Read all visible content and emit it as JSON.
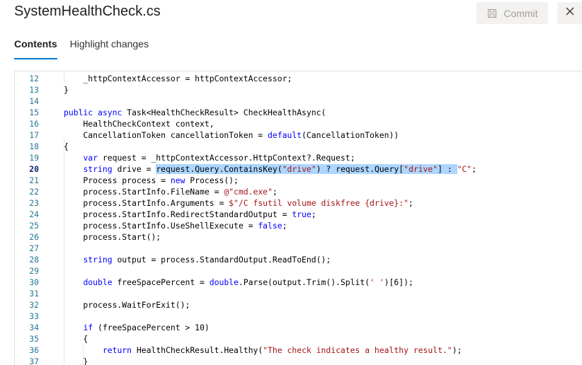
{
  "header": {
    "file_name": "SystemHealthCheck.cs",
    "commit_label": "Commit",
    "commit_icon": "save-icon",
    "close_icon": "close-icon"
  },
  "tabs": [
    {
      "label": "Contents",
      "active": true
    },
    {
      "label": "Highlight changes",
      "active": false
    }
  ],
  "editor": {
    "current_line": 20,
    "lines": [
      {
        "n": "12",
        "parts": [
          {
            "t": "        _httpContextAccessor = httpContextAccessor;"
          }
        ]
      },
      {
        "n": "13",
        "parts": [
          {
            "t": "    }"
          }
        ]
      },
      {
        "n": "14",
        "parts": [
          {
            "t": ""
          }
        ]
      },
      {
        "n": "15",
        "parts": [
          {
            "t": "    "
          },
          {
            "t": "public",
            "c": "kw"
          },
          {
            "t": " "
          },
          {
            "t": "async",
            "c": "kw"
          },
          {
            "t": " Task<HealthCheckResult> CheckHealthAsync("
          }
        ]
      },
      {
        "n": "16",
        "parts": [
          {
            "t": "        HealthCheckContext context,"
          }
        ]
      },
      {
        "n": "17",
        "parts": [
          {
            "t": "        CancellationToken cancellationToken = "
          },
          {
            "t": "default",
            "c": "kw"
          },
          {
            "t": "(CancellationToken))"
          }
        ]
      },
      {
        "n": "18",
        "parts": [
          {
            "t": "    {"
          }
        ]
      },
      {
        "n": "19",
        "parts": [
          {
            "t": "        "
          },
          {
            "t": "var",
            "c": "kw"
          },
          {
            "t": " request = _httpContextAccessor.HttpContext?.Request;"
          }
        ]
      },
      {
        "n": "20",
        "parts": [
          {
            "t": "        "
          },
          {
            "t": "string",
            "c": "kw"
          },
          {
            "t": " drive = "
          },
          {
            "t": "request.Query.ContainsKey(",
            "c": "sel"
          },
          {
            "t": "\"drive\"",
            "c": "sel str"
          },
          {
            "t": ") ? request.Query[",
            "c": "sel"
          },
          {
            "t": "\"drive\"",
            "c": "sel str"
          },
          {
            "t": "] : ",
            "c": "sel"
          },
          {
            "t": "\"C\"",
            "c": "str"
          },
          {
            "t": ";"
          }
        ]
      },
      {
        "n": "21",
        "parts": [
          {
            "t": "        Process process = "
          },
          {
            "t": "new",
            "c": "kw"
          },
          {
            "t": " Process();"
          }
        ]
      },
      {
        "n": "22",
        "parts": [
          {
            "t": "        process.StartInfo.FileName = "
          },
          {
            "t": "@\"cmd.exe\"",
            "c": "str"
          },
          {
            "t": ";"
          }
        ]
      },
      {
        "n": "23",
        "parts": [
          {
            "t": "        process.StartInfo.Arguments = "
          },
          {
            "t": "$\"/C fsutil volume diskfree {drive}:\"",
            "c": "str"
          },
          {
            "t": ";"
          }
        ]
      },
      {
        "n": "24",
        "parts": [
          {
            "t": "        process.StartInfo.RedirectStandardOutput = "
          },
          {
            "t": "true",
            "c": "kw"
          },
          {
            "t": ";"
          }
        ]
      },
      {
        "n": "25",
        "parts": [
          {
            "t": "        process.StartInfo.UseShellExecute = "
          },
          {
            "t": "false",
            "c": "kw"
          },
          {
            "t": ";"
          }
        ]
      },
      {
        "n": "26",
        "parts": [
          {
            "t": "        process.Start();"
          }
        ]
      },
      {
        "n": "27",
        "parts": [
          {
            "t": ""
          }
        ]
      },
      {
        "n": "28",
        "parts": [
          {
            "t": "        "
          },
          {
            "t": "string",
            "c": "kw"
          },
          {
            "t": " output = process.StandardOutput.ReadToEnd();"
          }
        ]
      },
      {
        "n": "29",
        "parts": [
          {
            "t": ""
          }
        ]
      },
      {
        "n": "30",
        "parts": [
          {
            "t": "        "
          },
          {
            "t": "double",
            "c": "kw"
          },
          {
            "t": " freeSpacePercent = "
          },
          {
            "t": "double",
            "c": "kw"
          },
          {
            "t": ".Parse(output.Trim().Split("
          },
          {
            "t": "' '",
            "c": "str"
          },
          {
            "t": ")[6]);"
          }
        ]
      },
      {
        "n": "31",
        "parts": [
          {
            "t": ""
          }
        ]
      },
      {
        "n": "32",
        "parts": [
          {
            "t": "        process.WaitForExit();"
          }
        ]
      },
      {
        "n": "33",
        "parts": [
          {
            "t": ""
          }
        ]
      },
      {
        "n": "34",
        "parts": [
          {
            "t": "        "
          },
          {
            "t": "if",
            "c": "kw"
          },
          {
            "t": " (freeSpacePercent > 10)"
          }
        ]
      },
      {
        "n": "35",
        "parts": [
          {
            "t": "        {"
          }
        ]
      },
      {
        "n": "36",
        "parts": [
          {
            "t": "            "
          },
          {
            "t": "return",
            "c": "kw"
          },
          {
            "t": " HealthCheckResult.Healthy("
          },
          {
            "t": "\"The check indicates a healthy result.\"",
            "c": "str"
          },
          {
            "t": ");"
          }
        ]
      },
      {
        "n": "37",
        "parts": [
          {
            "t": "        }"
          }
        ]
      }
    ]
  }
}
